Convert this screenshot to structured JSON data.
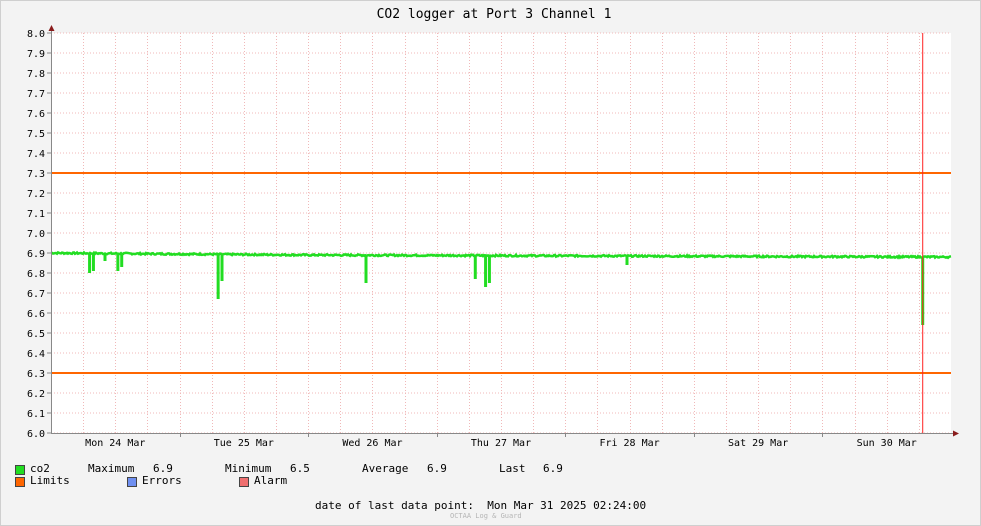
{
  "chart_data": {
    "type": "line",
    "title": "CO2 logger at Port 3 Channel 1",
    "ylim": [
      6.0,
      8.0
    ],
    "y_ticks": [
      "6.0",
      "6.1",
      "6.2",
      "6.3",
      "6.4",
      "6.5",
      "6.6",
      "6.7",
      "6.8",
      "6.9",
      "7.0",
      "7.1",
      "7.2",
      "7.3",
      "7.4",
      "7.5",
      "7.6",
      "7.7",
      "7.8",
      "7.9",
      "8.0"
    ],
    "x_range_days": [
      0,
      7
    ],
    "x_tick_labels": [
      "Mon 24 Mar",
      "Tue 25 Mar",
      "Wed 26 Mar",
      "Thu 27 Mar",
      "Fri 28 Mar",
      "Sat 29 Mar",
      "Sun 30 Mar"
    ],
    "grid": true,
    "limits": [
      7.3,
      6.3
    ],
    "alarm_marker_day": 6.78,
    "series": [
      {
        "name": "co2",
        "color": "#22dd22",
        "baseline": [
          [
            0.0,
            6.9
          ],
          [
            2.0,
            6.89
          ],
          [
            4.5,
            6.885
          ],
          [
            7.0,
            6.88
          ]
        ],
        "dips": [
          [
            0.3,
            6.8
          ],
          [
            0.33,
            6.81
          ],
          [
            0.42,
            6.86
          ],
          [
            0.52,
            6.81
          ],
          [
            0.55,
            6.83
          ],
          [
            1.3,
            6.67
          ],
          [
            1.33,
            6.76
          ],
          [
            2.45,
            6.75
          ],
          [
            3.3,
            6.77
          ],
          [
            3.38,
            6.73
          ],
          [
            3.41,
            6.75
          ],
          [
            4.48,
            6.84
          ],
          [
            6.78,
            6.54
          ]
        ]
      }
    ],
    "colors": {
      "limits": "#ff6600",
      "errors": "#6f8ff0",
      "alarm": "#ef6f6f",
      "alarm_line": "#ff2222"
    }
  },
  "legend": {
    "co2_label": "co2",
    "max_label": "Maximum",
    "max_value": "6.9",
    "min_label": "Minimum",
    "min_value": "6.5",
    "avg_label": "Average",
    "avg_value": "6.9",
    "last_label": "Last",
    "last_value": "6.9",
    "limits_label": "Limits",
    "errors_label": "Errors",
    "alarm_label": "Alarm"
  },
  "footer": {
    "date_label": "date of last data point:",
    "date_value": "Mon Mar 31 2025 02:24:00",
    "credit": "OCTAA Log & Guard"
  }
}
